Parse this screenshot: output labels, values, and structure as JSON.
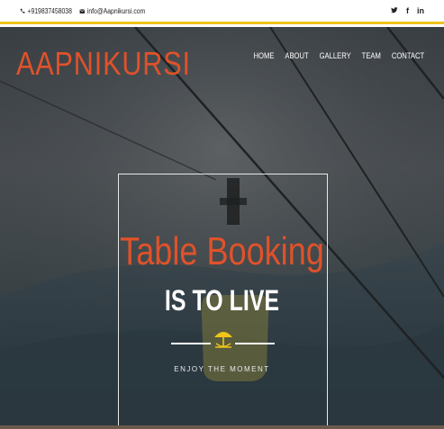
{
  "topbar": {
    "phone": "+919837458038",
    "email": "info@Aapnikursi.com",
    "social": [
      {
        "icon": "twitter-icon",
        "glyph": "🐦"
      },
      {
        "icon": "facebook-icon",
        "glyph": "f"
      },
      {
        "icon": "linkedin-icon",
        "glyph": "in"
      }
    ]
  },
  "header": {
    "logo": "AAPNIKURSI",
    "nav": [
      "HOME",
      "ABOUT",
      "GALLERY",
      "TEAM",
      "CONTACT"
    ]
  },
  "hero": {
    "headline": "Table Booking",
    "subline": "IS TO LIVE",
    "tagline": "ENJOY THE MOMENT"
  },
  "colors": {
    "accent": "#e0522a",
    "topbar_border": "#f0c419",
    "umbrella": "#f0c419"
  }
}
